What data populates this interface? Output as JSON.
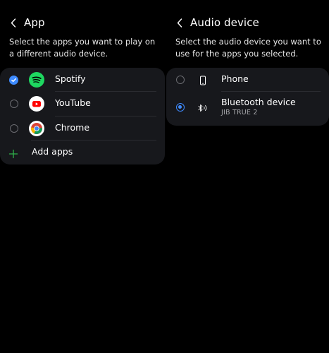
{
  "app_panel": {
    "title": "App",
    "description": "Select the apps you want to play on a different audio device.",
    "apps": [
      {
        "label": "Spotify",
        "selected": true,
        "icon": "spotify-icon"
      },
      {
        "label": "YouTube",
        "selected": false,
        "icon": "youtube-icon"
      },
      {
        "label": "Chrome",
        "selected": false,
        "icon": "chrome-icon"
      }
    ],
    "add_apps_label": "Add apps"
  },
  "audio_panel": {
    "title": "Audio device",
    "description": "Select the audio device you want to use for the apps you selected.",
    "devices": [
      {
        "label": "Phone",
        "sublabel": "",
        "selected": false,
        "icon": "phone-icon"
      },
      {
        "label": "Bluetooth device",
        "sublabel": "JIB TRUE 2",
        "selected": true,
        "icon": "bluetooth-audio-icon"
      }
    ]
  },
  "colors": {
    "accent": "#3e8bff",
    "card": "#17181c",
    "add_icon": "#2fb24a",
    "spotify": "#1ed760",
    "youtube": "#ff0000"
  }
}
